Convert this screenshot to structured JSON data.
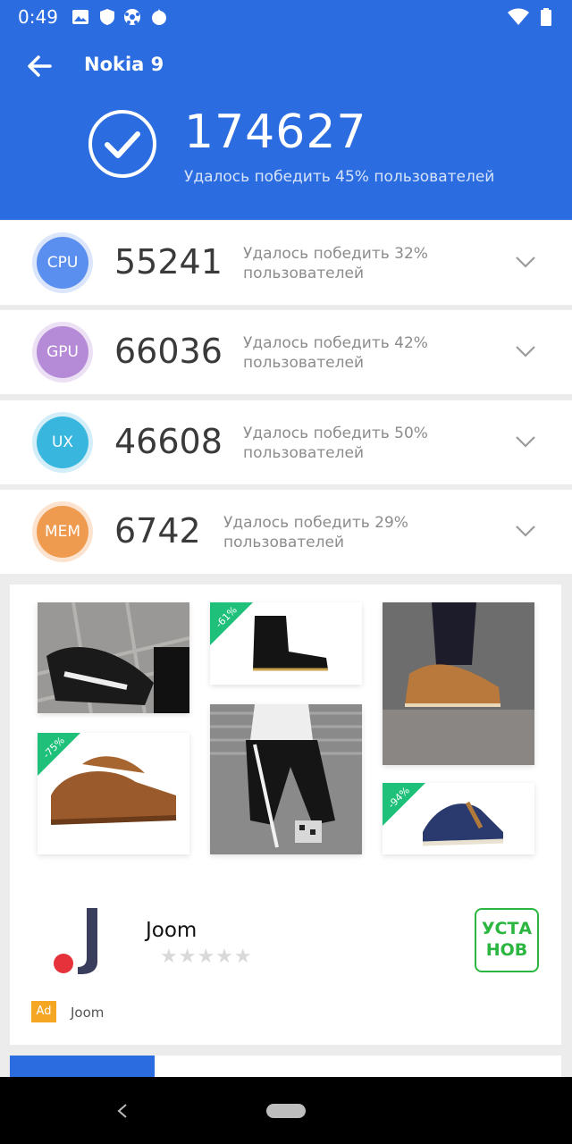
{
  "status_bar": {
    "time": "0:49"
  },
  "header": {
    "title": "Nokia 9",
    "total_score": "174627",
    "subtitle": "Удалось победить 45% пользователей",
    "background_color": "#2b6ce0"
  },
  "scores": [
    {
      "badge": "CPU",
      "score": "55241",
      "desc_line1": "Удалось победить 32%",
      "desc_line2": "пользователей",
      "color": "#5b8fef"
    },
    {
      "badge": "GPU",
      "score": "66036",
      "desc_line1": "Удалось победить 42%",
      "desc_line2": "пользователей",
      "color": "#b58ad6"
    },
    {
      "badge": "UX",
      "score": "46608",
      "desc_line1": "Удалось победить 50%",
      "desc_line2": "пользователей",
      "color": "#38b6de"
    },
    {
      "badge": "MEM",
      "score": "6742",
      "desc_line1": "Удалось победить 29%",
      "desc_line2": "пользователей",
      "color": "#ef9b4f"
    }
  ],
  "ad": {
    "discounts": [
      "-61%",
      "-75%",
      "-94%"
    ],
    "app_name": "Joom",
    "install_label_1": "УСТА",
    "install_label_2": "НОВ",
    "ad_tag": "Ad",
    "advertiser": "Joom",
    "rating_stars": "★★★★★"
  }
}
